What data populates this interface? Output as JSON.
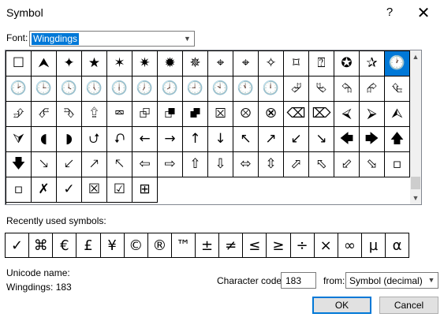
{
  "window": {
    "title": "Symbol",
    "help": "?",
    "close": "✕"
  },
  "font": {
    "label": "Font:",
    "value": "Wingdings"
  },
  "grid": {
    "rows": [
      [
        "☐",
        "⮝",
        "✦",
        "★",
        "✶",
        "✷",
        "✹",
        "✵",
        "⌖",
        "⌖",
        "✧",
        "⌑",
        "⍰",
        "✪",
        "✰",
        "🕐",
        "🕑"
      ],
      [
        "🕒",
        "🕓",
        "🕔",
        "🕕",
        "🕖",
        "🕗",
        "🕘",
        "🕙",
        "🕚",
        "🕛",
        "⮰",
        "⮱",
        "⮲",
        "⮳",
        "⮴",
        "⮵"
      ],
      [
        "⮶",
        "⮷",
        "⮸",
        "⮹",
        "⮺",
        "⮻",
        "⮼",
        "⮽",
        "⮾",
        "⮿",
        "⌫",
        "⌦",
        "⮘",
        "⮚",
        "⮙",
        "⮛"
      ],
      [
        "◖",
        "◗",
        "⮍",
        "⮏",
        "←",
        "→",
        "↑",
        "↓",
        "↖",
        "↗",
        "↙",
        "↘",
        "🡄",
        "🡆",
        "🡅",
        "🡇"
      ],
      [
        "🡖",
        "🡗",
        "🡕",
        "🡔",
        "⇦",
        "⇨",
        "⇧",
        "⇩",
        "⬄",
        "⇳",
        "⬀",
        "⬁",
        "⬃",
        "⬂",
        "▫",
        "▫",
        "✗",
        "✓"
      ],
      [
        "☒",
        "☑",
        "⊞"
      ]
    ],
    "selected_index": 15
  },
  "recent": {
    "label": "Recently used symbols:",
    "symbols": [
      "✓",
      "⌘",
      "€",
      "£",
      "¥",
      "©",
      "®",
      "™",
      "±",
      "≠",
      "≤",
      "≥",
      "÷",
      "×",
      "∞",
      "µ",
      "α"
    ]
  },
  "unicode": {
    "label": "Unicode name:",
    "value": "Wingdings: 183"
  },
  "charcode": {
    "label": "Character code:",
    "value": "183"
  },
  "from": {
    "label": "from:",
    "value": "Symbol (decimal)"
  },
  "buttons": {
    "ok": "OK",
    "cancel": "Cancel"
  }
}
